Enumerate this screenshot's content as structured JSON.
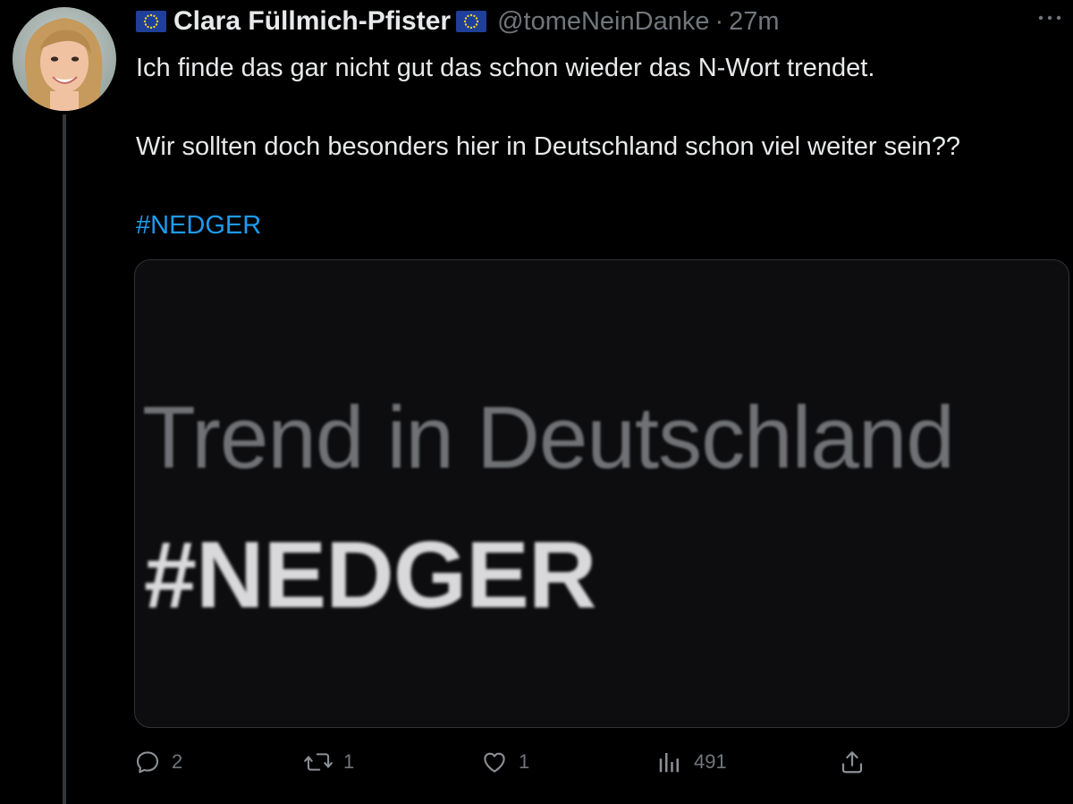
{
  "tweet": {
    "display_name": "Clara Füllmich-Pfister",
    "handle": "@tomeNeinDanke",
    "separator": "·",
    "time": "27m",
    "text_lines": [
      "Ich finde das gar nicht gut das schon wieder das N-Wort trendet.",
      "Wir sollten doch besonders hier in Deutschland schon viel weiter sein??"
    ],
    "hashtag": "#NEDGER",
    "media": {
      "subtitle": "Trend in Deutschland",
      "headline": "#NEDGER"
    },
    "actions": {
      "replies": "2",
      "retweets": "1",
      "likes": "1",
      "views": "491"
    }
  },
  "icons": {
    "flag": "eu-flag-icon",
    "more": "more-icon",
    "reply": "reply-icon",
    "retweet": "retweet-icon",
    "like": "heart-icon",
    "views": "views-icon",
    "share": "share-icon"
  },
  "colors": {
    "background": "#000000",
    "text": "#e7e9ea",
    "muted": "#71767b",
    "link": "#1d9bf0",
    "eu_blue": "#1f3f99",
    "eu_star": "#f7d417"
  }
}
